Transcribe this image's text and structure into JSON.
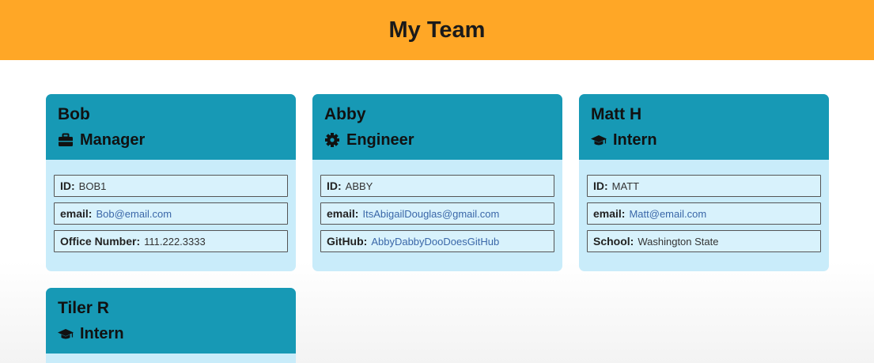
{
  "header": {
    "title": "My Team"
  },
  "cards": [
    {
      "name": "Bob",
      "role": "Manager",
      "role_icon": "briefcase-icon",
      "fields": [
        {
          "label": "ID:",
          "value": "BOB1"
        },
        {
          "label": "email:",
          "value": "Bob@email.com"
        },
        {
          "label": "Office Number:",
          "value": "111.222.3333"
        }
      ]
    },
    {
      "name": "Abby",
      "role": "Engineer",
      "role_icon": "cog-icon",
      "fields": [
        {
          "label": "ID:",
          "value": "ABBY"
        },
        {
          "label": "email:",
          "value": "ItsAbigailDouglas@gmail.com"
        },
        {
          "label": "GitHub:",
          "value": "AbbyDabbyDooDoesGitHub"
        }
      ]
    },
    {
      "name": "Matt H",
      "role": "Intern",
      "role_icon": "graduation-cap-icon",
      "fields": [
        {
          "label": "ID:",
          "value": "MATT"
        },
        {
          "label": "email:",
          "value": "Matt@email.com"
        },
        {
          "label": "School:",
          "value": "Washington State"
        }
      ]
    },
    {
      "name": "Tiler R",
      "role": "Intern",
      "role_icon": "graduation-cap-icon"
    }
  ],
  "colors": {
    "header_bg": "#ffa726",
    "card_header_bg": "#1799b5",
    "card_body_bg": "#c9ecfa",
    "link": "#3a67a8"
  }
}
